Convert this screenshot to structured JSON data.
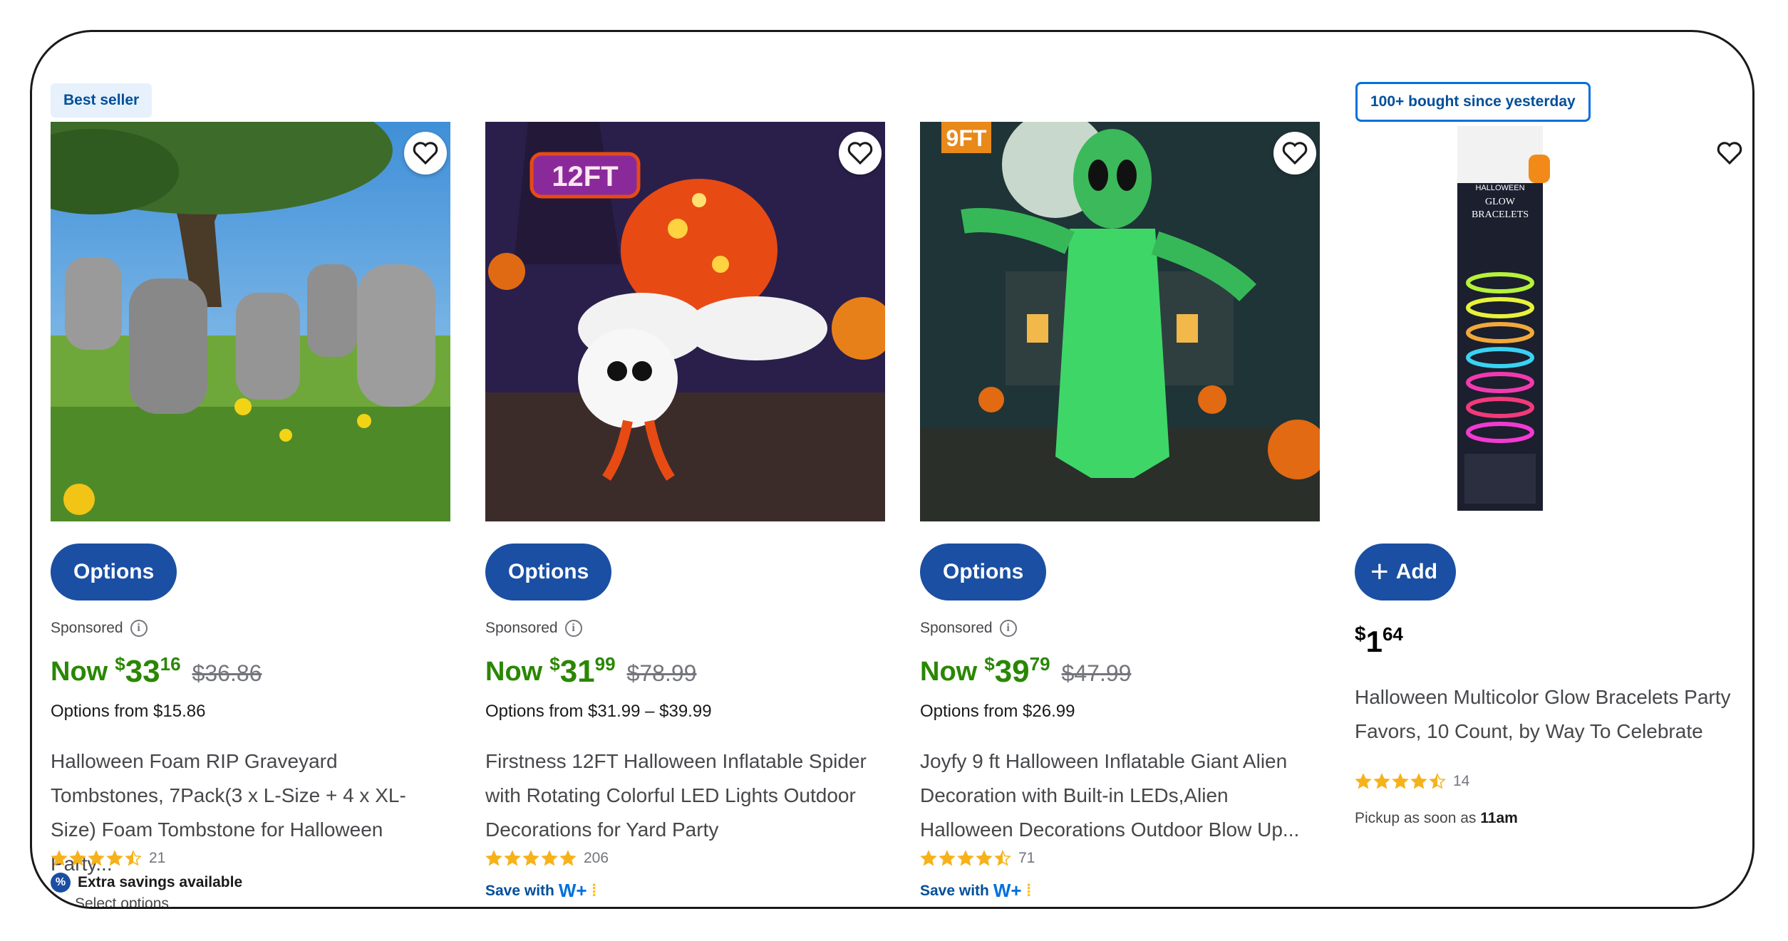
{
  "cards": [
    {
      "badge": "Best seller",
      "button_label": "Options",
      "sponsored": "Sponsored",
      "price_prefix": "Now",
      "currency": "$",
      "price_dollars": "33",
      "price_cents": "16",
      "was_price": "$36.86",
      "options_from": "Options from $15.86",
      "title": "Halloween Foam RIP Graveyard Tombstones, 7Pack(3 x L-Size + 4 x XL-Size) Foam Tombstone for Halloween Party...",
      "rating": 4.5,
      "review_count": "21",
      "extra_savings": "Extra savings available",
      "select_options": "Select options"
    },
    {
      "badge": "",
      "button_label": "Options",
      "sponsored": "Sponsored",
      "price_prefix": "Now",
      "currency": "$",
      "price_dollars": "31",
      "price_cents": "99",
      "was_price": "$78.99",
      "options_from": "Options from $31.99 – $39.99",
      "title": "Firstness 12FT Halloween Inflatable Spider with Rotating Colorful LED Lights Outdoor Decorations for Yard Party",
      "rating": 5,
      "review_count": "206",
      "save_with": "Save with",
      "save_with_brand": "W+",
      "image_label": "12FT"
    },
    {
      "badge": "",
      "button_label": "Options",
      "sponsored": "Sponsored",
      "price_prefix": "Now",
      "currency": "$",
      "price_dollars": "39",
      "price_cents": "79",
      "was_price": "$47.99",
      "options_from": "Options from $26.99",
      "title": "Joyfy 9 ft Halloween Inflatable Giant Alien Decoration with Built-in LEDs,Alien Halloween Decorations Outdoor Blow Up...",
      "rating": 4.5,
      "review_count": "71",
      "save_with": "Save with",
      "save_with_brand": "W+",
      "image_label": "9FT"
    },
    {
      "badge": "100+ bought since yesterday",
      "button_label": "Add",
      "currency": "$",
      "price_dollars": "1",
      "price_cents": "64",
      "title": "Halloween Multicolor Glow Bracelets Party Favors, 10 Count, by Way To Celebrate",
      "rating": 4.5,
      "review_count": "14",
      "pickup_prefix": "Pickup as soon as",
      "pickup_time": "11am",
      "package_text": "HALLOWEEN GLOW BRACELETS"
    }
  ],
  "colors": {
    "price_green": "#2a8703",
    "button_blue": "#1a4fa3",
    "star_yellow": "#f6b21b",
    "badge_blue": "#004f9a"
  }
}
